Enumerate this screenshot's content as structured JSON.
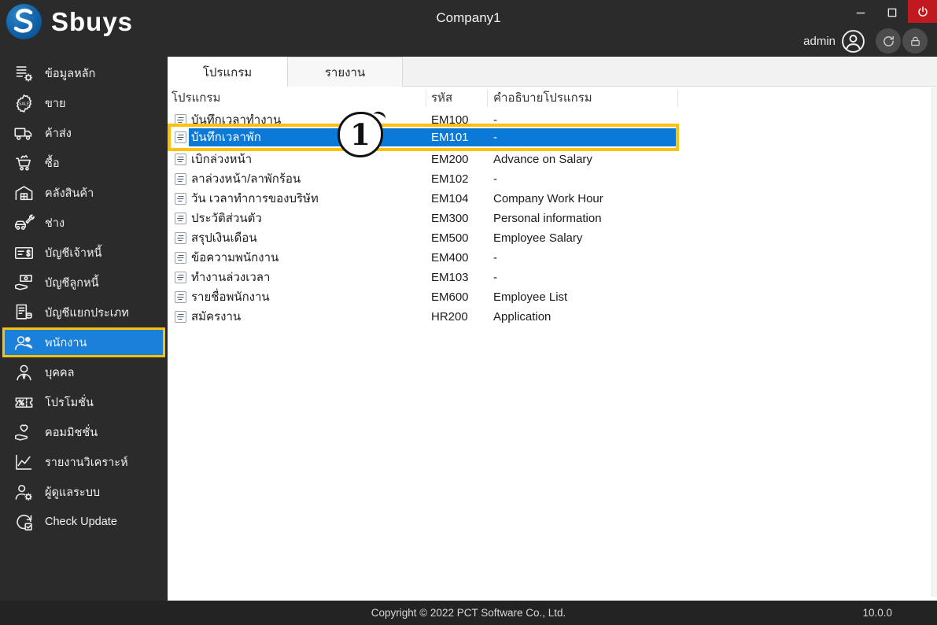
{
  "window": {
    "title": "Company1",
    "user": "admin",
    "copyright": "Copyright © 2022 PCT Software Co., Ltd.",
    "version": "10.0.0"
  },
  "brand": {
    "name": "Sbuys"
  },
  "sidebar": {
    "items": [
      {
        "id": "master-data",
        "label": "ข้อมูลหลัก",
        "icon": "master-data-icon",
        "selected": false
      },
      {
        "id": "sales",
        "label": "ขาย",
        "icon": "sale-badge-icon",
        "selected": false
      },
      {
        "id": "wholesale",
        "label": "ค้าส่ง",
        "icon": "truck-icon",
        "selected": false
      },
      {
        "id": "purchase",
        "label": "ซื้อ",
        "icon": "cart-icon",
        "selected": false
      },
      {
        "id": "inventory",
        "label": "คลังสินค้า",
        "icon": "warehouse-icon",
        "selected": false
      },
      {
        "id": "mechanic",
        "label": "ช่าง",
        "icon": "car-wrench-icon",
        "selected": false
      },
      {
        "id": "accounts-payable",
        "label": "บัญชีเจ้าหนี้",
        "icon": "invoice-dollar-icon",
        "selected": false
      },
      {
        "id": "accounts-receivable",
        "label": "บัญชีลูกหนี้",
        "icon": "hand-money-icon",
        "selected": false
      },
      {
        "id": "general-ledger",
        "label": "บัญชีแยกประเภท",
        "icon": "ledger-coins-icon",
        "selected": false
      },
      {
        "id": "employees",
        "label": "พนักงาน",
        "icon": "employees-icon",
        "selected": true
      },
      {
        "id": "persons",
        "label": "บุคคล",
        "icon": "person-icon",
        "selected": false
      },
      {
        "id": "promotion",
        "label": "โปรโมชั่น",
        "icon": "coupon-icon",
        "selected": false
      },
      {
        "id": "commission",
        "label": "คอมมิชชั่น",
        "icon": "hand-heart-icon",
        "selected": false
      },
      {
        "id": "analysis-report",
        "label": "รายงานวิเคราะห์",
        "icon": "chart-icon",
        "selected": false
      },
      {
        "id": "administrator",
        "label": "ผู้ดูแลระบบ",
        "icon": "admin-gear-icon",
        "selected": false
      },
      {
        "id": "check-update",
        "label": "Check Update",
        "icon": "update-check-icon",
        "selected": false
      }
    ]
  },
  "tabs": [
    {
      "id": "programs",
      "label": "โปรแกรม",
      "active": true
    },
    {
      "id": "reports",
      "label": "รายงาน",
      "active": false
    }
  ],
  "table": {
    "columns": [
      {
        "key": "name",
        "label": "โปรแกรม"
      },
      {
        "key": "code",
        "label": "รหัส"
      },
      {
        "key": "desc",
        "label": "คำอธิบายโปรแกรม"
      }
    ],
    "row_icon": "form-icon",
    "rows": [
      {
        "name": "บันทึกเวลาทำงาน",
        "code": "EM100",
        "desc": "-",
        "selected": false
      },
      {
        "name": "บันทึกเวลาพัก",
        "code": "EM101",
        "desc": "-",
        "selected": true
      },
      {
        "name": "เบิกล่วงหน้า",
        "code": "EM200",
        "desc": "Advance on Salary",
        "selected": false
      },
      {
        "name": "ลาล่วงหน้า/ลาพักร้อน",
        "code": "EM102",
        "desc": "-",
        "selected": false
      },
      {
        "name": "วัน เวลาทำการของบริษัท",
        "code": "EM104",
        "desc": "Company Work Hour",
        "selected": false
      },
      {
        "name": "ประวัติส่วนตัว",
        "code": "EM300",
        "desc": "Personal information",
        "selected": false
      },
      {
        "name": "สรุปเงินเดือน",
        "code": "EM500",
        "desc": "Employee Salary",
        "selected": false
      },
      {
        "name": "ข้อความพนักงาน",
        "code": "EM400",
        "desc": "-",
        "selected": false
      },
      {
        "name": "ทำงานล่วงเวลา",
        "code": "EM103",
        "desc": "-",
        "selected": false
      },
      {
        "name": "รายชื่อพนักงาน",
        "code": "EM600",
        "desc": "Employee List",
        "selected": false
      },
      {
        "name": "สมัครงาน",
        "code": "HR200",
        "desc": "Application",
        "selected": false
      }
    ]
  },
  "annotation": {
    "label": "1"
  },
  "colors": {
    "topbar_bg": "#2b2b2b",
    "bottombar_bg": "#232323",
    "selection_blue": "#0b79d7",
    "sidebar_selected_blue": "#1b80d9",
    "highlight_yellow": "#fdc107",
    "power_red": "#c01920",
    "logo_blue": "#1162a8"
  }
}
